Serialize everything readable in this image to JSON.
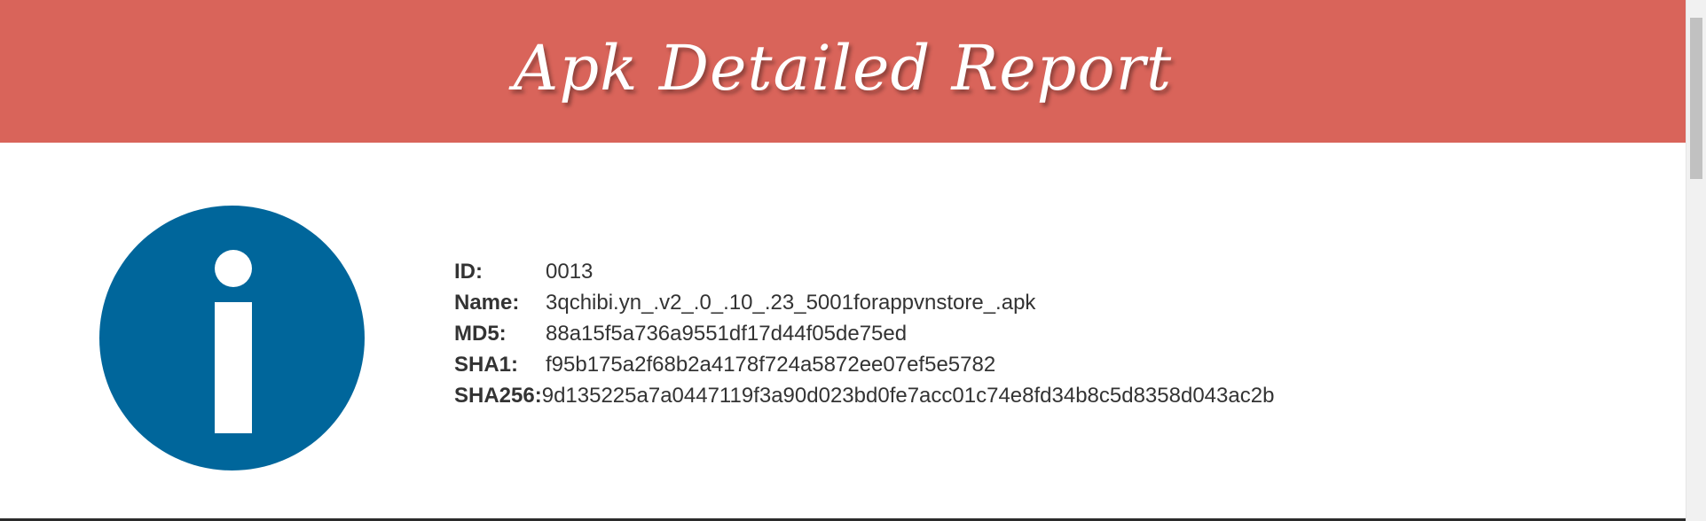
{
  "header": {
    "title": "Apk Detailed Report",
    "background": "#d9645a"
  },
  "icon": {
    "name": "info-icon",
    "color": "#00669b"
  },
  "details": [
    {
      "label": "ID:",
      "value": "0013"
    },
    {
      "label": "Name:",
      "value": "3qchibi.yn_.v2_.0_.10_.23_5001forappvnstore_.apk"
    },
    {
      "label": "MD5:",
      "value": "88a15f5a736a9551df17d44f05de75ed"
    },
    {
      "label": "SHA1:",
      "value": "f95b175a2f68b2a4178f724a5872ee07ef5e5782"
    },
    {
      "label": "SHA256:",
      "value": "9d135225a7a0447119f3a90d023bd0fe7acc01c74e8fd34b8c5d8358d043ac2b"
    }
  ]
}
